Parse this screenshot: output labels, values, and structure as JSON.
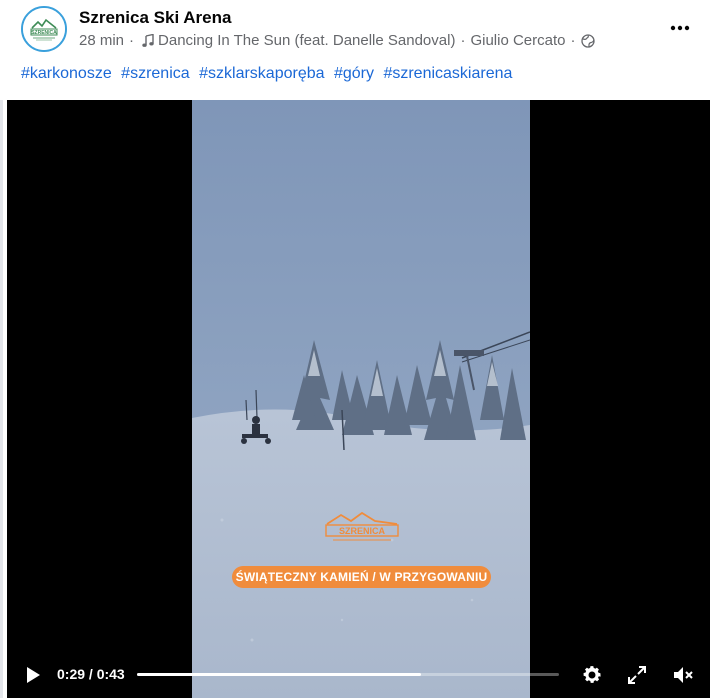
{
  "post": {
    "page_name": "Szrenica Ski Arena",
    "time_ago": "28 min",
    "separator": "·",
    "song": "Dancing In The Sun (feat. Danelle Sandoval)",
    "artist": "Giulio Cercato",
    "audience_icon": "globe-icon",
    "more_icon": "more-options-icon",
    "hashtags": [
      "#karkonosze",
      "#szrenica",
      "#szklarskaporęba",
      "#góry",
      "#szrenicaskiarena"
    ]
  },
  "avatar": {
    "logo_text": "SZRENICA"
  },
  "video": {
    "overlay_logo_text": "SZRENICA",
    "caption": "ŚWIĄTECZNY KAMIEŃ / W PRZYGOWANIU",
    "current_time": "0:29",
    "duration": "0:43",
    "time_display": "0:29 / 0:43",
    "progress": 0.674,
    "icons": [
      "play-icon",
      "settings-icon",
      "fullscreen-icon",
      "mute-icon"
    ]
  },
  "colors": {
    "hashtag": "#1b68d6",
    "caption_pill": "#f08c3c",
    "brand_green": "#3d8b55",
    "avatar_ring": "#3aa0dc"
  }
}
